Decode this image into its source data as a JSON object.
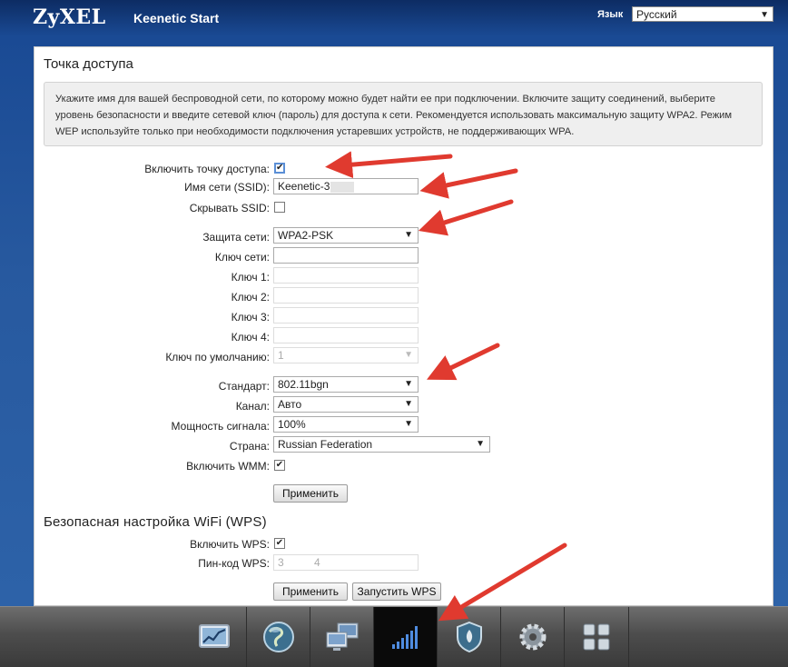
{
  "header": {
    "brand": "ZyXEL",
    "model": "Keenetic Start",
    "language_label": "Язык",
    "language_value": "Русский"
  },
  "access_point": {
    "title": "Точка доступа",
    "info": "Укажите имя для вашей беспроводной сети, по которому можно будет найти ее при подключении. Включите защиту соединений, выберите уровень безопасности и введите сетевой ключ (пароль) для доступа к сети. Рекомендуется использовать максимальную защиту WPA2. Режим WEP используйте только при необходимости подключения устаревших устройств, не поддерживающих WPA.",
    "enable_label": "Включить точку доступа:",
    "enable_checked": true,
    "ssid_label": "Имя сети (SSID):",
    "ssid_value": "Keenetic-3",
    "hide_ssid_label": "Скрывать SSID:",
    "hide_ssid_checked": false,
    "security_label": "Защита сети:",
    "security_value": "WPA2-PSK",
    "network_key_label": "Ключ сети:",
    "network_key_value": "",
    "key1_label": "Ключ 1:",
    "key2_label": "Ключ 2:",
    "key3_label": "Ключ 3:",
    "key4_label": "Ключ 4:",
    "default_key_label": "Ключ по умолчанию:",
    "default_key_value": "1",
    "standard_label": "Стандарт:",
    "standard_value": "802.11bgn",
    "channel_label": "Канал:",
    "channel_value": "Авто",
    "power_label": "Мощность сигнала:",
    "power_value": "100%",
    "country_label": "Страна:",
    "country_value": "Russian Federation",
    "wmm_label": "Включить WMM:",
    "wmm_checked": true,
    "apply_label": "Применить"
  },
  "wps": {
    "title": "Безопасная настройка WiFi (WPS)",
    "enable_label": "Включить WPS:",
    "enable_checked": true,
    "pin_label": "Пин-код WPS:",
    "pin_value": "3          4",
    "apply_label": "Применить",
    "start_label": "Запустить WPS"
  },
  "taskbar": {
    "items": [
      "monitor-icon",
      "globe-icon",
      "network-icon",
      "wifi-signal-icon",
      "shield-icon",
      "gear-icon",
      "apps-grid-icon"
    ],
    "active": "wifi-signal-icon"
  },
  "colors": {
    "annotation_arrow": "#e03a2f",
    "background": "#27599f",
    "taskbar_active": "#0a0a0a"
  }
}
